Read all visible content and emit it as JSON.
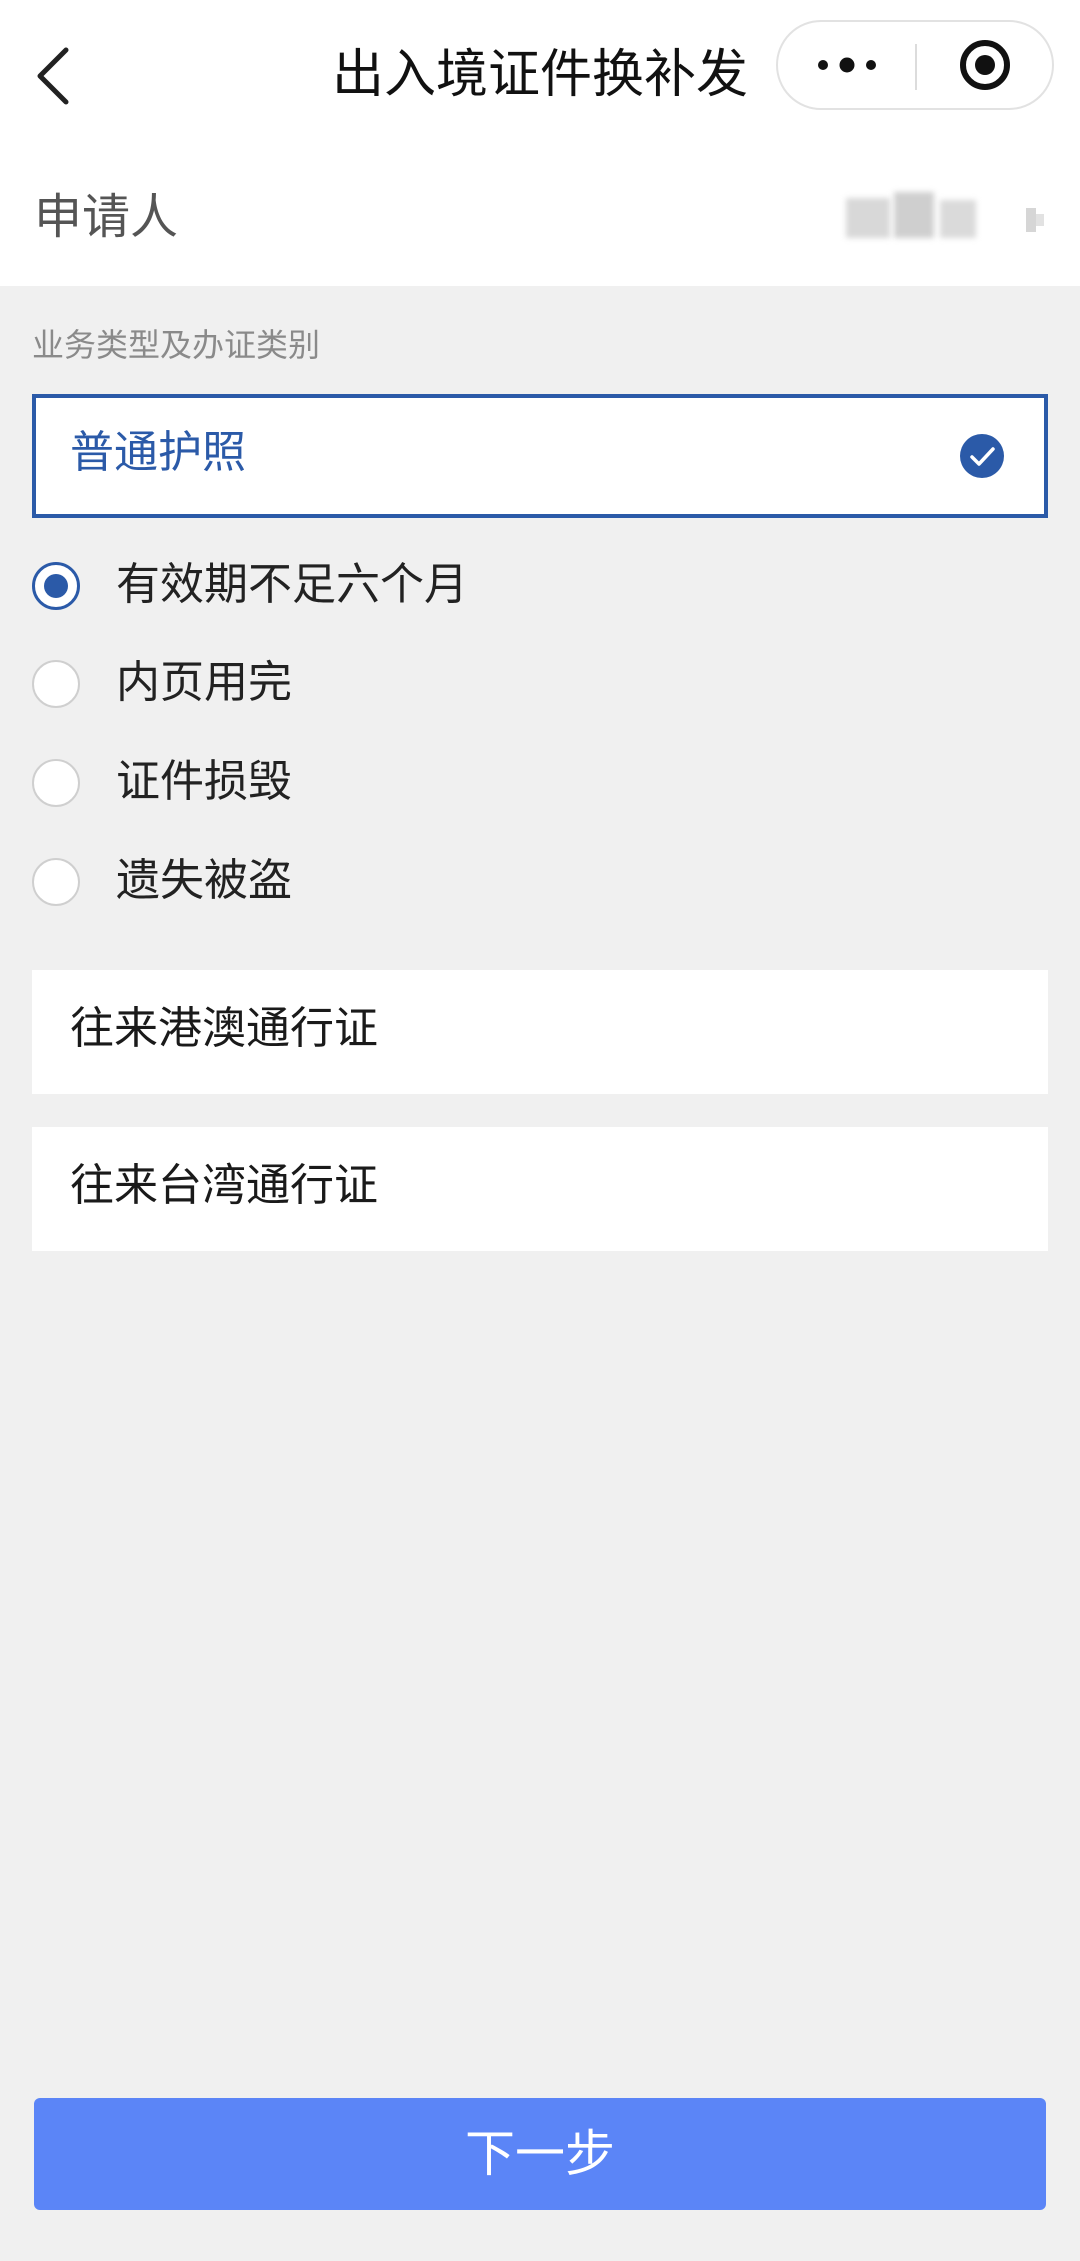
{
  "header": {
    "title": "出入境证件换补发",
    "back_icon": "chevron-left-icon",
    "more_icon": "more-dots-icon",
    "close_icon": "record-circle-icon"
  },
  "applicant": {
    "label": "申请人",
    "value": "(redacted)"
  },
  "section": {
    "label": "业务类型及办证类别"
  },
  "options": [
    {
      "label": "普通护照",
      "selected": true,
      "reasons": [
        {
          "label": "有效期不足六个月",
          "checked": true
        },
        {
          "label": "内页用完",
          "checked": false
        },
        {
          "label": "证件损毁",
          "checked": false
        },
        {
          "label": "遗失被盗",
          "checked": false
        }
      ]
    },
    {
      "label": "往来港澳通行证",
      "selected": false
    },
    {
      "label": "往来台湾通行证",
      "selected": false
    }
  ],
  "footer": {
    "next_label": "下一步"
  },
  "colors": {
    "accent": "#2b5aa8",
    "button": "#5b85f7",
    "background": "#f0f0f0"
  }
}
